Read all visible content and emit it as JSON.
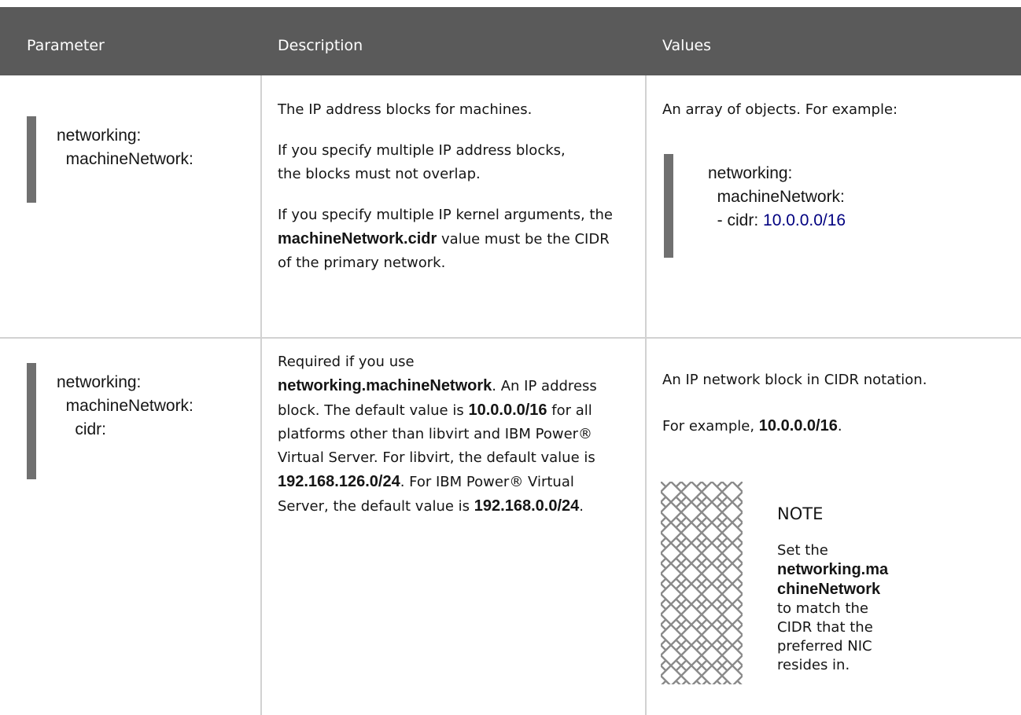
{
  "header": {
    "parameter": "Parameter",
    "description": "Description",
    "values": "Values"
  },
  "rows": [
    {
      "param_lines": "networking:\n  machineNetwork:",
      "desc_p1": "The IP address blocks for machines.",
      "desc_p2": "If you specify multiple IP address blocks, the blocks must not overlap.",
      "desc_p3_pre": "If you specify multiple IP kernel arguments, the",
      "desc_p3_bold": "machineNetwork.cidr",
      "desc_p3_post": " value must be the CIDR of the primary network.",
      "values_text": "An array of objects. For example:",
      "code_l1": "networking:",
      "code_l2": "  machineNetwork:",
      "code_l3_pre": "  - cidr: ",
      "code_l3_num": "10.0.0.0/16"
    },
    {
      "param_lines": "networking:\n  machineNetwork:\n    cidr:",
      "desc_a": "Required if you use",
      "desc_b_bold": "networking.machineNetwork",
      "desc_c": ". An IP address block. The default value is",
      "desc_d_bold": "10.0.0.0/16",
      "desc_e": " for all platforms other than libvirt and IBM Power® Virtual Server. For libvirt, the default value is",
      "desc_f_bold": "192.168.126.0/24",
      "desc_g": ". For IBM Power® Virtual Server, the default value is",
      "desc_h_bold": "192.168.0.0/24",
      "desc_i": ".",
      "values_text": "An IP network block in CIDR notation.",
      "example_pre": "For example, ",
      "example_bold": "10.0.0.0/16",
      "example_post": ".",
      "note_title": "NOTE",
      "note_pre": "Set the",
      "note_bold": "networking.machineNetwork",
      "note_post": " to match the CIDR that the preferred NIC resides in."
    }
  ]
}
